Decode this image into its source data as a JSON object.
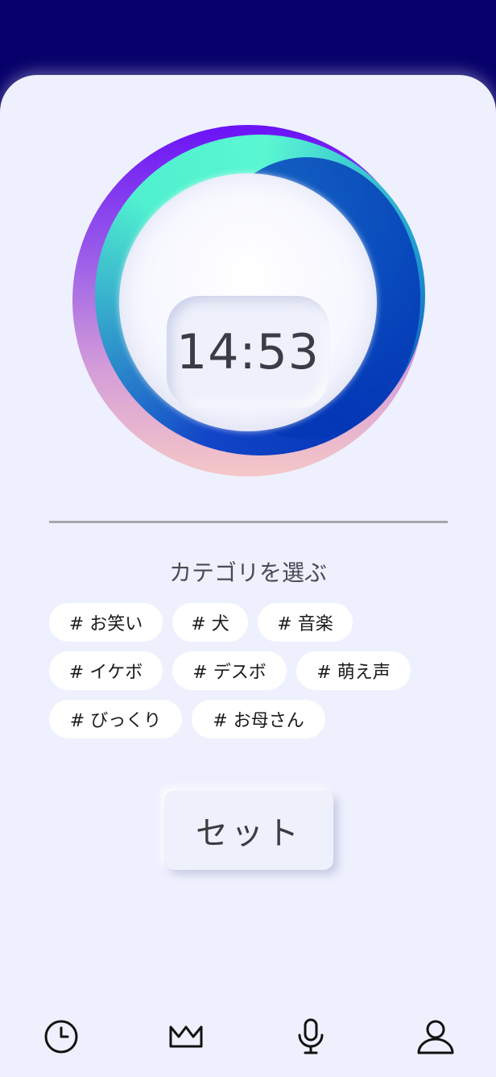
{
  "clock": {
    "time": "14:53"
  },
  "category": {
    "title": "カテゴリを選ぶ",
    "tags": [
      "# お笑い",
      "# 犬",
      "# 音楽",
      "# イケボ",
      "# デスボ",
      "# 萌え声",
      "# びっくり",
      "# お母さん"
    ]
  },
  "set_button": {
    "label": "セット"
  },
  "nav": {
    "icons": [
      "clock-icon",
      "crown-icon",
      "microphone-icon",
      "user-icon"
    ]
  },
  "colors": {
    "header_bg": "#07006b",
    "card_bg": "#eef0fe",
    "ring_purple": "#6a12f7",
    "ring_teal": "#4ff0cf",
    "ring_blue": "#0438b6"
  }
}
